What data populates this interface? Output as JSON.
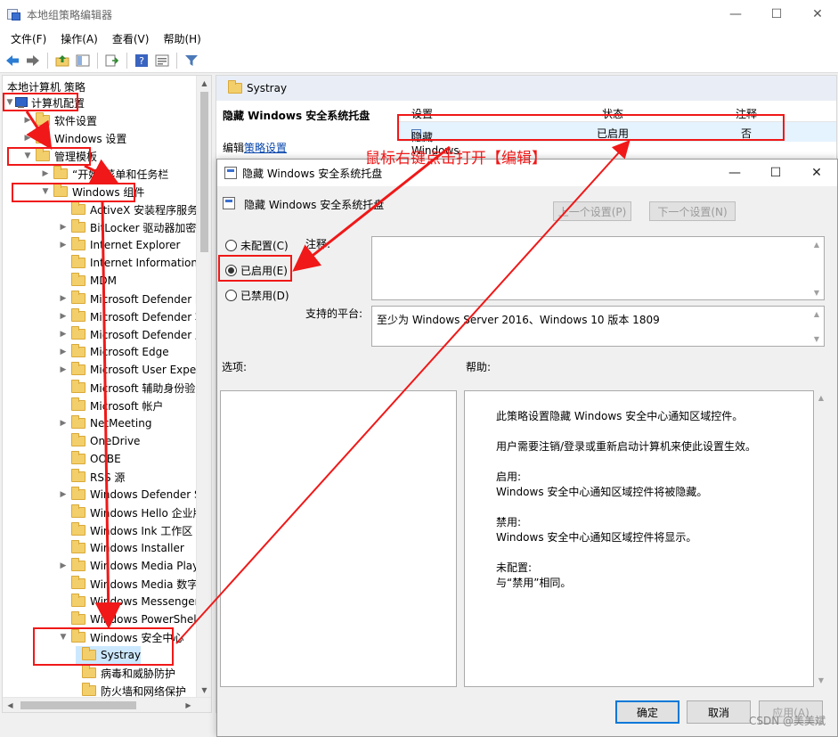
{
  "window": {
    "title": "本地组策略编辑器",
    "minimize": "—",
    "maximize": "☐",
    "close": "✕"
  },
  "menu": [
    "文件(F)",
    "操作(A)",
    "查看(V)",
    "帮助(H)"
  ],
  "toolbar": {
    "icons": [
      "back-icon",
      "forward-icon",
      "up-folder-icon",
      "show-hide-tree-icon",
      "export-list-icon",
      "help-icon",
      "properties-icon",
      "filter-icon"
    ]
  },
  "tree": {
    "root": "本地计算机 策略",
    "items": [
      {
        "label": "计算机配置",
        "level": 0,
        "expanded": true,
        "icon": "computer"
      },
      {
        "label": "软件设置",
        "level": 1,
        "expanded": false
      },
      {
        "label": "Windows 设置",
        "level": 1,
        "expanded": false
      },
      {
        "label": "管理模板",
        "level": 1,
        "expanded": true
      },
      {
        "label": "“开始”菜单和任务栏",
        "level": 2,
        "expanded": false
      },
      {
        "label": "Windows 组件",
        "level": 2,
        "expanded": true
      },
      {
        "label": "ActiveX 安装程序服务",
        "level": 3,
        "expander": false
      },
      {
        "label": "BitLocker 驱动器加密",
        "level": 3,
        "expander": true
      },
      {
        "label": "Internet Explorer",
        "level": 3,
        "expander": true
      },
      {
        "label": "Internet Information Ser",
        "level": 3,
        "expander": false
      },
      {
        "label": "MDM",
        "level": 3,
        "expander": false
      },
      {
        "label": "Microsoft Defender 防病",
        "level": 3,
        "expander": true
      },
      {
        "label": "Microsoft Defender 攻击",
        "level": 3,
        "expander": true
      },
      {
        "label": "Microsoft Defender 应用",
        "level": 3,
        "expander": true
      },
      {
        "label": "Microsoft Edge",
        "level": 3,
        "expander": true
      },
      {
        "label": "Microsoft User Experien",
        "level": 3,
        "expander": true
      },
      {
        "label": "Microsoft 辅助身份验证",
        "level": 3,
        "expander": false
      },
      {
        "label": "Microsoft 帐户",
        "level": 3,
        "expander": false
      },
      {
        "label": "NetMeeting",
        "level": 3,
        "expander": true
      },
      {
        "label": "OneDrive",
        "level": 3,
        "expander": false
      },
      {
        "label": "OOBE",
        "level": 3,
        "expander": false
      },
      {
        "label": "RSS 源",
        "level": 3,
        "expander": false
      },
      {
        "label": "Windows Defender Sma",
        "level": 3,
        "expander": true
      },
      {
        "label": "Windows Hello 企业版",
        "level": 3,
        "expander": false
      },
      {
        "label": "Windows Ink 工作区",
        "level": 3,
        "expander": false
      },
      {
        "label": "Windows Installer",
        "level": 3,
        "expander": false
      },
      {
        "label": "Windows Media Player",
        "level": 3,
        "expander": true
      },
      {
        "label": "Windows Media 数字权限",
        "level": 3,
        "expander": false
      },
      {
        "label": "Windows Messenger",
        "level": 3,
        "expander": false
      },
      {
        "label": "Windows PowerShell",
        "level": 3,
        "expander": false
      },
      {
        "label": "Windows 安全中心",
        "level": 3,
        "expanded": true
      },
      {
        "label": "Systray",
        "level": 4,
        "selected": true
      },
      {
        "label": "病毒和威胁防护",
        "level": 4
      },
      {
        "label": "防火墙和网络保护",
        "level": 4
      }
    ]
  },
  "right_pane": {
    "header": "Systray",
    "policy_title": "隐藏 Windows 安全系统托盘",
    "edit_prefix": "编辑",
    "edit_link": "策略设置",
    "columns": [
      "设置",
      "状态",
      "注释"
    ],
    "row": {
      "setting": "隐藏 Windows 安全系统托盘",
      "state": "已启用",
      "comment": "否"
    }
  },
  "dialog": {
    "title": "隐藏 Windows 安全系统托盘",
    "header_name": "隐藏 Windows 安全系统托盘",
    "prev_button": "上一个设置(P)",
    "next_button": "下一个设置(N)",
    "radios": [
      {
        "label": "未配置(C)",
        "checked": false
      },
      {
        "label": "已启用(E)",
        "checked": true
      },
      {
        "label": "已禁用(D)",
        "checked": false
      }
    ],
    "comment_label": "注释:",
    "platform_label": "支持的平台:",
    "platform_value": "至少为 Windows Server 2016、Windows 10 版本 1809",
    "options_label": "选项:",
    "help_label": "帮助:",
    "help_paragraphs": [
      [
        "此策略设置隐藏 Windows 安全中心通知区域控件。"
      ],
      [
        "用户需要注销/登录或重新启动计算机来使此设置生效。"
      ],
      [
        "启用:",
        "Windows 安全中心通知区域控件将被隐藏。"
      ],
      [
        "禁用:",
        "Windows 安全中心通知区域控件将显示。"
      ],
      [
        "未配置:",
        "与“禁用”相同。"
      ]
    ],
    "ok_button": "确定",
    "cancel_button": "取消",
    "apply_button": "应用(A)"
  },
  "annotation": {
    "text": "鼠标右键点击打开【编辑】",
    "color": "#f01818"
  },
  "watermark": "CSDN @美美斌"
}
